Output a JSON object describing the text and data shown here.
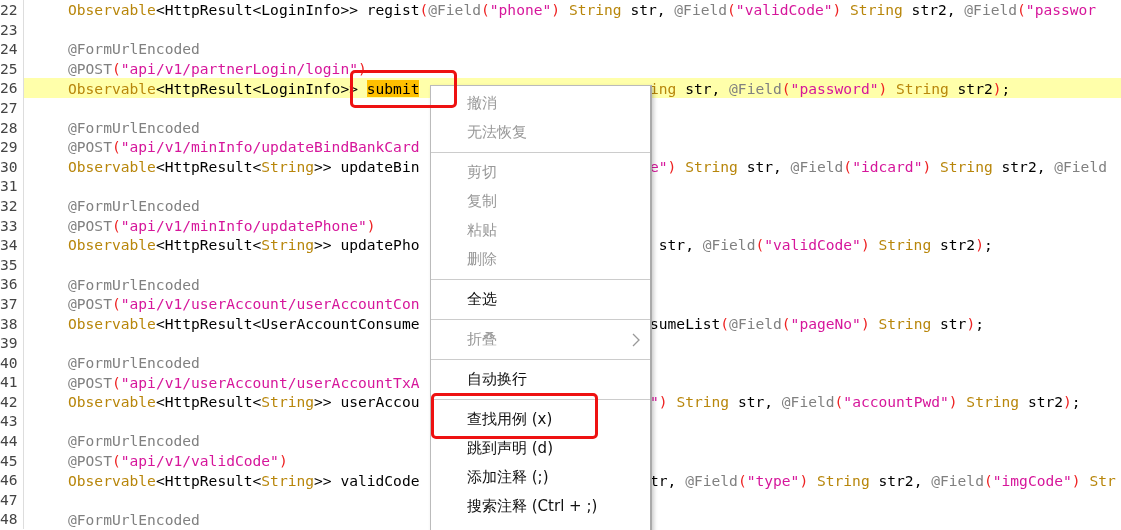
{
  "code_lines": [
    {
      "number": "22",
      "current": false,
      "left": [
        {
          "kind": "type",
          "text": "Observable"
        },
        {
          "kind": "plain",
          "text": "<HttpResult<LoginInfo>> regist"
        },
        {
          "kind": "paren",
          "text": "("
        },
        {
          "kind": "anno",
          "text": "@Field"
        },
        {
          "kind": "paren",
          "text": "("
        },
        {
          "kind": "str",
          "text": "\"phone\""
        },
        {
          "kind": "paren",
          "text": ")"
        },
        {
          "kind": "type",
          "text": " String"
        },
        {
          "kind": "plain",
          "text": " str, "
        },
        {
          "kind": "anno",
          "text": "@Field"
        },
        {
          "kind": "paren",
          "text": "("
        },
        {
          "kind": "str",
          "text": "\"validCode\""
        },
        {
          "kind": "paren",
          "text": ")"
        },
        {
          "kind": "type",
          "text": " String"
        },
        {
          "kind": "plain",
          "text": " str2, "
        },
        {
          "kind": "anno",
          "text": "@Field"
        },
        {
          "kind": "paren",
          "text": "("
        },
        {
          "kind": "str",
          "text": "\"passwor"
        }
      ]
    },
    {
      "number": "23",
      "current": false
    },
    {
      "number": "24",
      "current": false,
      "left": [
        {
          "kind": "anno",
          "text": "@FormUrlEncoded"
        }
      ]
    },
    {
      "number": "25",
      "current": false,
      "left": [
        {
          "kind": "anno",
          "text": "@POST"
        },
        {
          "kind": "paren",
          "text": "("
        },
        {
          "kind": "str",
          "text": "\"api/v1/partnerLogin/login\""
        },
        {
          "kind": "paren",
          "text": ")"
        }
      ]
    },
    {
      "number": "26",
      "current": true,
      "left": [
        {
          "kind": "type",
          "text": "Observable"
        },
        {
          "kind": "plain",
          "text": "<HttpResult<LoginInfo>> "
        },
        {
          "kind": "match",
          "text": "submit",
          "marked": true
        }
      ],
      "right": [
        {
          "kind": "type",
          "text": "ing"
        },
        {
          "kind": "plain",
          "text": " str, "
        },
        {
          "kind": "anno",
          "text": "@Field"
        },
        {
          "kind": "paren",
          "text": "("
        },
        {
          "kind": "str",
          "text": "\"password\""
        },
        {
          "kind": "paren",
          "text": ")"
        },
        {
          "kind": "type",
          "text": " String"
        },
        {
          "kind": "plain",
          "text": " str2"
        },
        {
          "kind": "paren",
          "text": ")"
        },
        {
          "kind": "plain",
          "text": ";"
        }
      ]
    },
    {
      "number": "27",
      "current": false
    },
    {
      "number": "28",
      "current": false,
      "left": [
        {
          "kind": "anno",
          "text": "@FormUrlEncoded"
        }
      ]
    },
    {
      "number": "29",
      "current": false,
      "left": [
        {
          "kind": "anno",
          "text": "@POST"
        },
        {
          "kind": "paren",
          "text": "("
        },
        {
          "kind": "str",
          "text": "\"api/v1/minInfo/updateBindBankCard"
        }
      ]
    },
    {
      "number": "30",
      "current": false,
      "left": [
        {
          "kind": "type",
          "text": "Observable"
        },
        {
          "kind": "plain",
          "text": "<HttpResult<"
        },
        {
          "kind": "type",
          "text": "String"
        },
        {
          "kind": "plain",
          "text": ">> updateBin"
        }
      ],
      "right": [
        {
          "kind": "str",
          "text": "e\""
        },
        {
          "kind": "paren",
          "text": ")"
        },
        {
          "kind": "type",
          "text": " String"
        },
        {
          "kind": "plain",
          "text": " str, "
        },
        {
          "kind": "anno",
          "text": "@Field"
        },
        {
          "kind": "paren",
          "text": "("
        },
        {
          "kind": "str",
          "text": "\"idcard\""
        },
        {
          "kind": "paren",
          "text": ")"
        },
        {
          "kind": "type",
          "text": " String"
        },
        {
          "kind": "plain",
          "text": " str2, "
        },
        {
          "kind": "anno",
          "text": "@Field"
        }
      ]
    },
    {
      "number": "31",
      "current": false
    },
    {
      "number": "32",
      "current": false,
      "left": [
        {
          "kind": "anno",
          "text": "@FormUrlEncoded"
        }
      ]
    },
    {
      "number": "33",
      "current": false,
      "left": [
        {
          "kind": "anno",
          "text": "@POST"
        },
        {
          "kind": "paren",
          "text": "("
        },
        {
          "kind": "str",
          "text": "\"api/v1/minInfo/updatePhone\""
        },
        {
          "kind": "paren",
          "text": ")"
        }
      ]
    },
    {
      "number": "34",
      "current": false,
      "left": [
        {
          "kind": "type",
          "text": "Observable"
        },
        {
          "kind": "plain",
          "text": "<HttpResult<"
        },
        {
          "kind": "type",
          "text": "String"
        },
        {
          "kind": "plain",
          "text": ">> updatePho"
        }
      ],
      "right": [
        {
          "kind": "plain",
          "text": " str, "
        },
        {
          "kind": "anno",
          "text": "@Field"
        },
        {
          "kind": "paren",
          "text": "("
        },
        {
          "kind": "str",
          "text": "\"validCode\""
        },
        {
          "kind": "paren",
          "text": ")"
        },
        {
          "kind": "type",
          "text": " String"
        },
        {
          "kind": "plain",
          "text": " str2"
        },
        {
          "kind": "paren",
          "text": ")"
        },
        {
          "kind": "plain",
          "text": ";"
        }
      ]
    },
    {
      "number": "35",
      "current": false
    },
    {
      "number": "36",
      "current": false,
      "left": [
        {
          "kind": "anno",
          "text": "@FormUrlEncoded"
        }
      ]
    },
    {
      "number": "37",
      "current": false,
      "left": [
        {
          "kind": "anno",
          "text": "@POST"
        },
        {
          "kind": "paren",
          "text": "("
        },
        {
          "kind": "str",
          "text": "\"api/v1/userAccount/userAccountCon"
        }
      ]
    },
    {
      "number": "38",
      "current": false,
      "left": [
        {
          "kind": "type",
          "text": "Observable"
        },
        {
          "kind": "plain",
          "text": "<HttpResult<UserAccountConsume"
        }
      ],
      "right": [
        {
          "kind": "plain",
          "text": "sumeList"
        },
        {
          "kind": "paren",
          "text": "("
        },
        {
          "kind": "anno",
          "text": "@Field"
        },
        {
          "kind": "paren",
          "text": "("
        },
        {
          "kind": "str",
          "text": "\"pageNo\""
        },
        {
          "kind": "paren",
          "text": ")"
        },
        {
          "kind": "type",
          "text": " String"
        },
        {
          "kind": "plain",
          "text": " str"
        },
        {
          "kind": "paren",
          "text": ")"
        },
        {
          "kind": "plain",
          "text": ";"
        }
      ]
    },
    {
      "number": "39",
      "current": false
    },
    {
      "number": "40",
      "current": false,
      "left": [
        {
          "kind": "anno",
          "text": "@FormUrlEncoded"
        }
      ]
    },
    {
      "number": "41",
      "current": false,
      "left": [
        {
          "kind": "anno",
          "text": "@POST"
        },
        {
          "kind": "paren",
          "text": "("
        },
        {
          "kind": "str",
          "text": "\"api/v1/userAccount/userAccountTxA"
        }
      ]
    },
    {
      "number": "42",
      "current": false,
      "left": [
        {
          "kind": "type",
          "text": "Observable"
        },
        {
          "kind": "plain",
          "text": "<HttpResult<"
        },
        {
          "kind": "type",
          "text": "String"
        },
        {
          "kind": "plain",
          "text": ">> userAccou"
        }
      ],
      "right": [
        {
          "kind": "str",
          "text": "\""
        },
        {
          "kind": "paren",
          "text": ")"
        },
        {
          "kind": "type",
          "text": " String"
        },
        {
          "kind": "plain",
          "text": " str, "
        },
        {
          "kind": "anno",
          "text": "@Field"
        },
        {
          "kind": "paren",
          "text": "("
        },
        {
          "kind": "str",
          "text": "\"accountPwd\""
        },
        {
          "kind": "paren",
          "text": ")"
        },
        {
          "kind": "type",
          "text": " String"
        },
        {
          "kind": "plain",
          "text": " str2"
        },
        {
          "kind": "paren",
          "text": ")"
        },
        {
          "kind": "plain",
          "text": ";"
        }
      ]
    },
    {
      "number": "43",
      "current": false
    },
    {
      "number": "44",
      "current": false,
      "left": [
        {
          "kind": "anno",
          "text": "@FormUrlEncoded"
        }
      ]
    },
    {
      "number": "45",
      "current": false,
      "left": [
        {
          "kind": "anno",
          "text": "@POST"
        },
        {
          "kind": "paren",
          "text": "("
        },
        {
          "kind": "str",
          "text": "\"api/v1/validCode\""
        },
        {
          "kind": "paren",
          "text": ")"
        }
      ]
    },
    {
      "number": "46",
      "current": false,
      "left": [
        {
          "kind": "type",
          "text": "Observable"
        },
        {
          "kind": "plain",
          "text": "<HttpResult<"
        },
        {
          "kind": "type",
          "text": "String"
        },
        {
          "kind": "plain",
          "text": ">> validCode"
        }
      ],
      "right": [
        {
          "kind": "plain",
          "text": "tr, "
        },
        {
          "kind": "anno",
          "text": "@Field"
        },
        {
          "kind": "paren",
          "text": "("
        },
        {
          "kind": "str",
          "text": "\"type\""
        },
        {
          "kind": "paren",
          "text": ")"
        },
        {
          "kind": "type",
          "text": " String"
        },
        {
          "kind": "plain",
          "text": " str2, "
        },
        {
          "kind": "anno",
          "text": "@Field"
        },
        {
          "kind": "paren",
          "text": "("
        },
        {
          "kind": "str",
          "text": "\"imgCode\""
        },
        {
          "kind": "paren",
          "text": ")"
        },
        {
          "kind": "type",
          "text": " Str"
        }
      ]
    },
    {
      "number": "47",
      "current": false
    },
    {
      "number": "48",
      "current": false,
      "left": [
        {
          "kind": "anno",
          "text": "@FormUrlEncoded"
        }
      ]
    }
  ],
  "context_menu": [
    {
      "kind": "item",
      "label": "撤消",
      "disabled": true
    },
    {
      "kind": "item",
      "label": "无法恢复",
      "disabled": true
    },
    {
      "kind": "separator"
    },
    {
      "kind": "item",
      "label": "剪切",
      "disabled": true
    },
    {
      "kind": "item",
      "label": "复制",
      "disabled": true
    },
    {
      "kind": "item",
      "label": "粘贴",
      "disabled": true
    },
    {
      "kind": "item",
      "label": "删除",
      "disabled": true
    },
    {
      "kind": "separator"
    },
    {
      "kind": "item",
      "label": "全选",
      "disabled": false
    },
    {
      "kind": "separator"
    },
    {
      "kind": "item",
      "label": "折叠",
      "disabled": true,
      "submenu": true
    },
    {
      "kind": "separator"
    },
    {
      "kind": "item",
      "label": "自动换行",
      "disabled": false
    },
    {
      "kind": "separator"
    },
    {
      "kind": "item",
      "label": "查找用例 (x)",
      "disabled": false,
      "marked": true
    },
    {
      "kind": "item",
      "label": "跳到声明 (d)",
      "disabled": false
    },
    {
      "kind": "item",
      "label": "添加注释 (;)",
      "disabled": false
    },
    {
      "kind": "item",
      "label": "搜索注释 (Ctrl + ;)",
      "disabled": false
    }
  ]
}
